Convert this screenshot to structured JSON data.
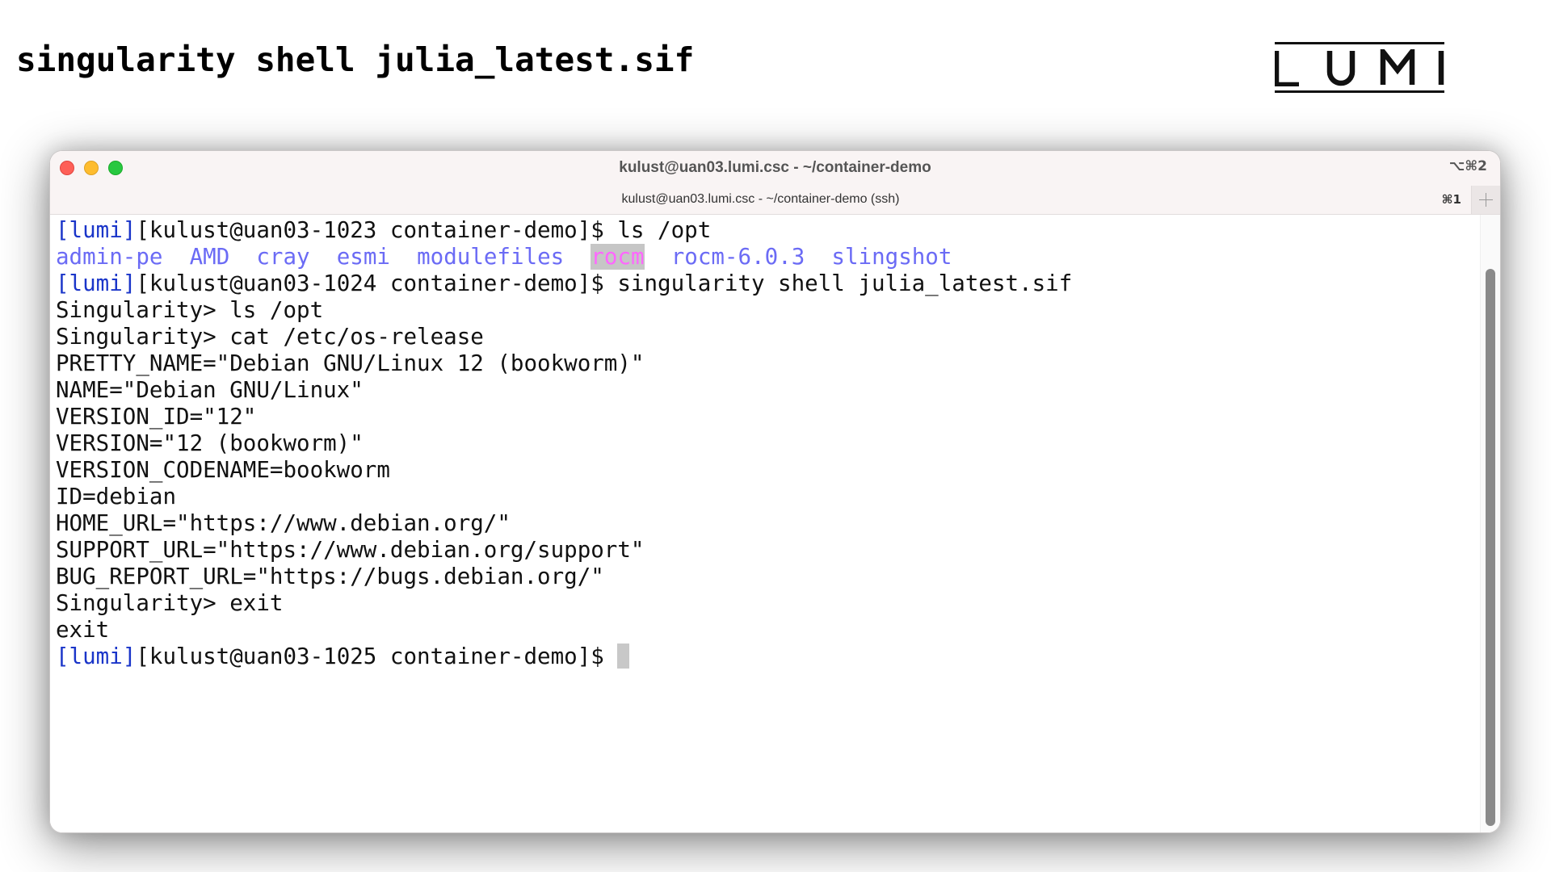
{
  "slide": {
    "title": "singularity shell julia_latest.sif",
    "logo_text": "LUMI"
  },
  "window": {
    "title": "kulust@uan03.lumi.csc - ~/container-demo",
    "shortcut": "⌥⌘2",
    "tabs": [
      {
        "label": "kulust@uan03.lumi.csc - ~/container-demo (ssh)",
        "shortcut": "⌘1",
        "active": true
      }
    ],
    "new_tab_label": "+"
  },
  "terminal": {
    "lines": [
      {
        "type": "prompt",
        "prefix": "[lumi]",
        "prompt": "[kulust@uan03-1023 container-demo]$ ",
        "command": "ls /opt"
      },
      {
        "type": "ls",
        "entries": [
          "admin-pe",
          "AMD",
          "cray",
          "esmi",
          "modulefiles",
          "rocm",
          "rocm-6.0.3",
          "slingshot"
        ],
        "highlighted": "rocm"
      },
      {
        "type": "prompt",
        "prefix": "[lumi]",
        "prompt": "[kulust@uan03-1024 container-demo]$ ",
        "command": "singularity shell julia_latest.sif"
      },
      {
        "type": "text",
        "text": "Singularity> ls /opt"
      },
      {
        "type": "text",
        "text": "Singularity> cat /etc/os-release"
      },
      {
        "type": "text",
        "text": "PRETTY_NAME=\"Debian GNU/Linux 12 (bookworm)\""
      },
      {
        "type": "text",
        "text": "NAME=\"Debian GNU/Linux\""
      },
      {
        "type": "text",
        "text": "VERSION_ID=\"12\""
      },
      {
        "type": "text",
        "text": "VERSION=\"12 (bookworm)\""
      },
      {
        "type": "text",
        "text": "VERSION_CODENAME=bookworm"
      },
      {
        "type": "text",
        "text": "ID=debian"
      },
      {
        "type": "text",
        "text": "HOME_URL=\"https://www.debian.org/\""
      },
      {
        "type": "text",
        "text": "SUPPORT_URL=\"https://www.debian.org/support\""
      },
      {
        "type": "text",
        "text": "BUG_REPORT_URL=\"https://bugs.debian.org/\""
      },
      {
        "type": "text",
        "text": "Singularity> exit"
      },
      {
        "type": "text",
        "text": "exit"
      },
      {
        "type": "prompt",
        "prefix": "[lumi]",
        "prompt": "[kulust@uan03-1025 container-demo]$ ",
        "command": "",
        "cursor": true
      }
    ]
  },
  "colors": {
    "prompt_prefix": "#1a35c9",
    "directory": "#6b6bf5",
    "highlight_text": "#ff66ff",
    "highlight_bg": "#c6c6c6",
    "traffic_close": "#fe5f57",
    "traffic_minimize": "#febc2e",
    "traffic_zoom": "#28c840"
  }
}
